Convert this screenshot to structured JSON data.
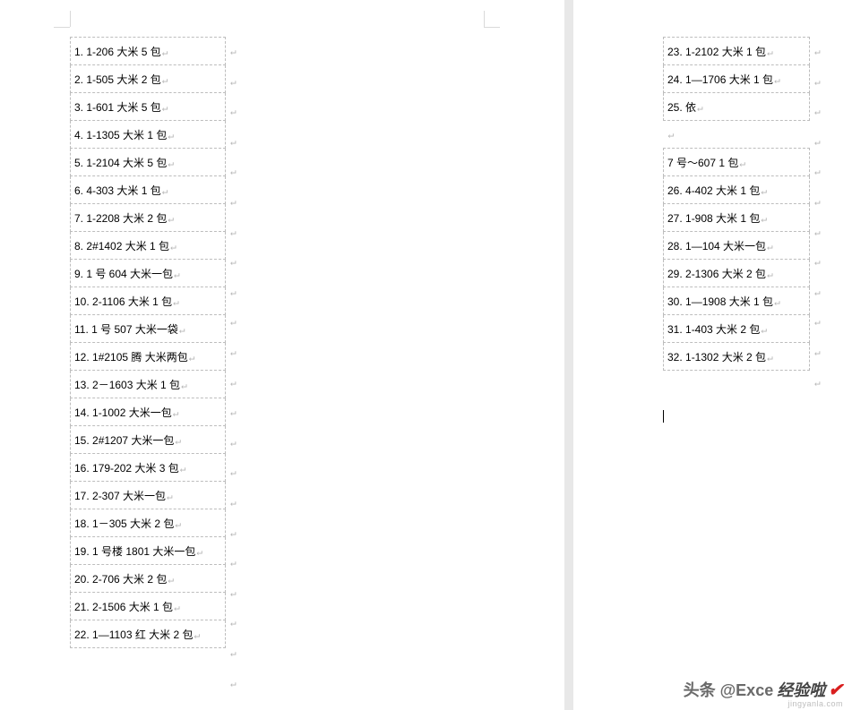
{
  "left_column": [
    "1. 1-206 大米 5 包",
    "2. 1-505 大米 2 包",
    "3. 1-601 大米 5 包",
    "4. 1-1305 大米 1 包",
    "5. 1-2104 大米 5 包",
    "6. 4-303 大米 1 包",
    "7. 1-2208 大米 2 包",
    "8. 2#1402 大米 1 包",
    "9. 1 号 604 大米一包",
    "10. 2-1106 大米 1 包",
    "11. 1 号 507 大米一袋",
    "12. 1#2105 腾 大米两包",
    "13. 2－1603 大米 1 包",
    "14. 1-1002 大米一包",
    "15. 2#1207 大米一包",
    "16. 179-202 大米 3 包",
    "17. 2-307   大米一包",
    "18. 1－305 大米 2 包",
    "19. 1 号楼 1801 大米一包",
    "20. 2-706 大米 2 包",
    "21. 2-1506 大米 1 包",
    "22. 1—1103 红 大米 2 包"
  ],
  "right_column": {
    "rows": [
      "23. 1-2102 大米 1 包",
      "24. 1—1706 大米 1 包",
      "25. 依"
    ],
    "gap_row": "",
    "extra_row": "7 号～607 1 包",
    "rows2": [
      "26. 4-402 大米 1 包",
      "27. 1-908 大米 1 包",
      "28. 1—104 大米一包",
      "29. 2-1306 大米 2 包",
      "30. 1—1908 大米 1 包",
      "31. 1-403 大米 2 包",
      "32. 1-1302 大米 2 包"
    ]
  },
  "watermark": {
    "left": "头条 @Exce",
    "right": "经验啦",
    "url": "jingyanla.com"
  },
  "marks": {
    "return": "↵"
  }
}
